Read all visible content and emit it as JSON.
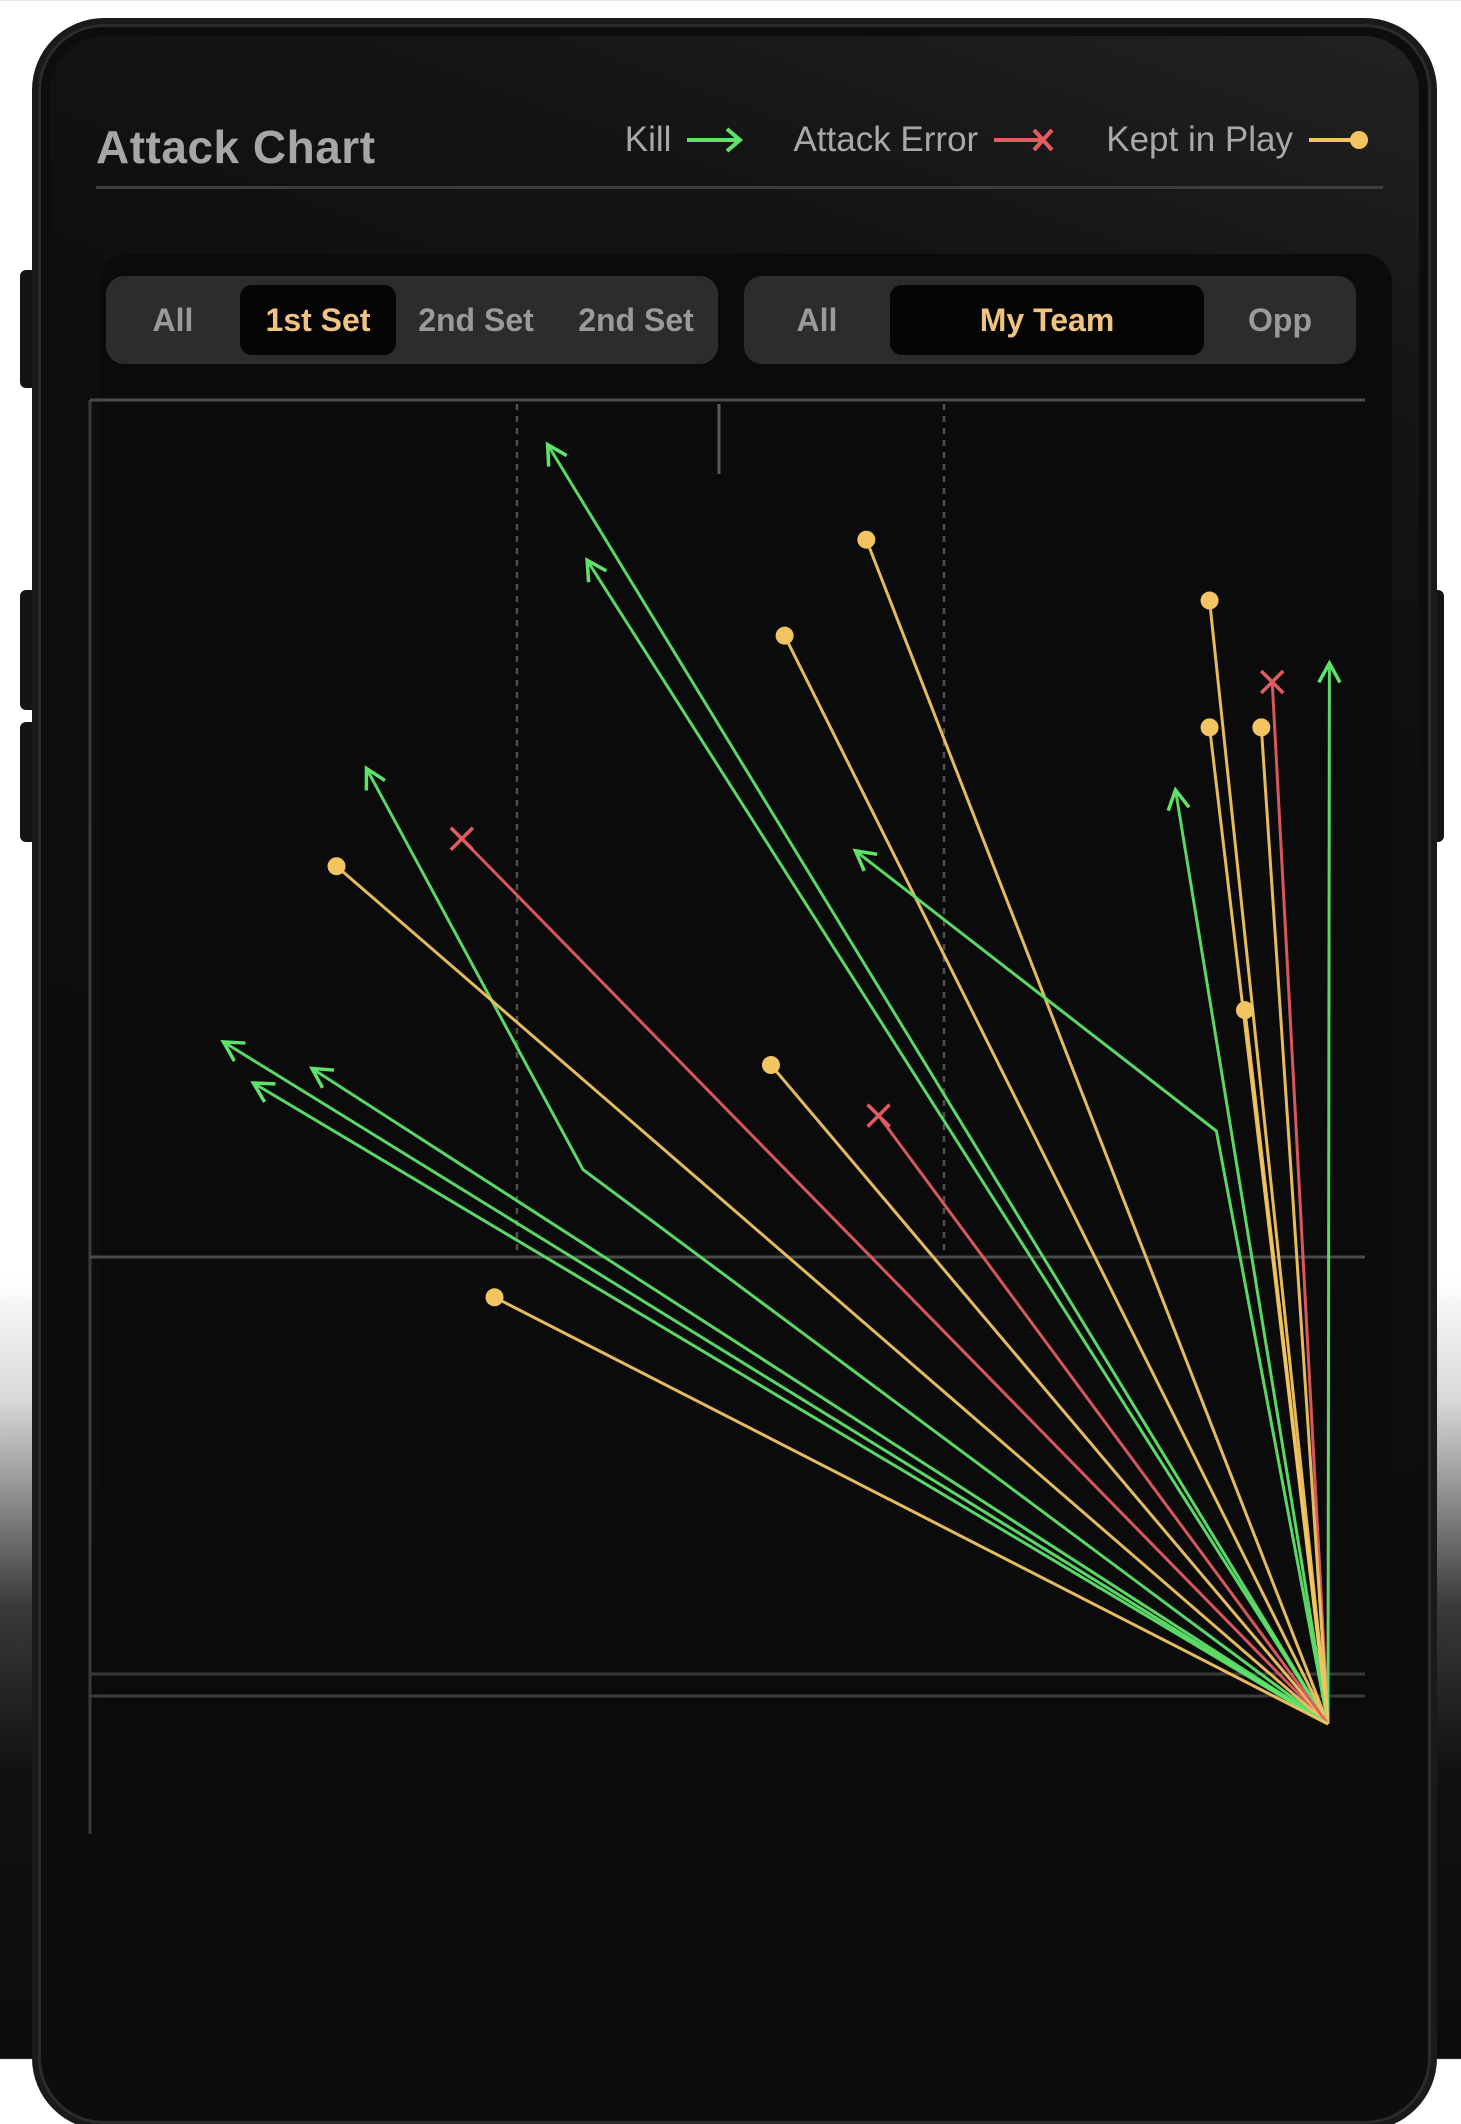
{
  "title": "Attack Chart",
  "legend": [
    {
      "label": "Kill",
      "type": "kill",
      "color": "#5fe36a"
    },
    {
      "label": "Attack Error",
      "type": "error",
      "color": "#e25c62"
    },
    {
      "label": "Kept in Play",
      "type": "kept",
      "color": "#f2c562"
    }
  ],
  "set_filter": {
    "options": [
      "All",
      "1st Set",
      "2nd Set",
      "2nd Set"
    ],
    "selected": "1st Set"
  },
  "team_filter": {
    "options": [
      "All",
      "My Team",
      "Opp"
    ],
    "selected": "My Team"
  },
  "colors": {
    "kill": "#5fe36a",
    "error": "#e25c62",
    "kept": "#f2c562",
    "accent": "#f0c382"
  },
  "attacks": [
    {
      "result": "kill",
      "via": null,
      "to": [
        0.336,
        0.052
      ]
    },
    {
      "result": "kill",
      "via": null,
      "to": [
        0.365,
        0.187
      ]
    },
    {
      "result": "kept",
      "via": null,
      "to": [
        0.57,
        0.163
      ]
    },
    {
      "result": "kept",
      "via": null,
      "to": [
        0.51,
        0.275
      ]
    },
    {
      "result": "kept",
      "via": null,
      "to": [
        0.822,
        0.234
      ]
    },
    {
      "result": "error",
      "via": null,
      "to": [
        0.868,
        0.329
      ]
    },
    {
      "result": "kill",
      "via": null,
      "to": [
        0.91,
        0.307
      ]
    },
    {
      "result": "kept",
      "via": null,
      "to": [
        0.822,
        0.382
      ]
    },
    {
      "result": "kept",
      "via": null,
      "to": [
        0.86,
        0.382
      ]
    },
    {
      "result": "kill",
      "via": null,
      "to": [
        0.797,
        0.455
      ]
    },
    {
      "result": "kill",
      "via": [
        0.827,
        0.853
      ],
      "to": [
        0.562,
        0.526
      ]
    },
    {
      "result": "kept",
      "via": null,
      "to": [
        0.848,
        0.712
      ]
    },
    {
      "result": "kill",
      "via": [
        0.362,
        0.898
      ],
      "to": [
        0.203,
        0.43
      ]
    },
    {
      "result": "error",
      "via": null,
      "to": [
        0.273,
        0.512
      ]
    },
    {
      "result": "kept",
      "via": null,
      "to": [
        0.181,
        0.544
      ]
    },
    {
      "result": "kept",
      "via": null,
      "to": [
        0.5,
        0.776
      ]
    },
    {
      "result": "error",
      "via": null,
      "to": [
        0.579,
        0.835
      ]
    },
    {
      "result": "kill",
      "via": null,
      "to": [
        0.098,
        0.749
      ]
    },
    {
      "result": "kill",
      "via": null,
      "to": [
        0.163,
        0.78
      ]
    },
    {
      "result": "kill",
      "via": null,
      "to": [
        0.12,
        0.797
      ]
    },
    {
      "result": "kept",
      "via": null,
      "to": [
        0.297,
        1.047
      ]
    }
  ]
}
